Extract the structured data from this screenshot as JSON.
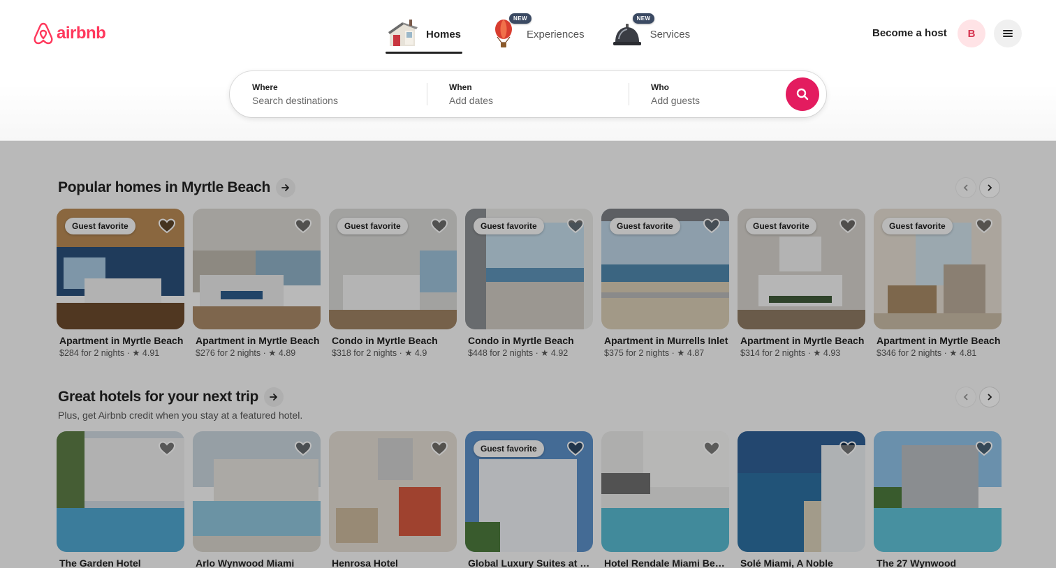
{
  "brand": {
    "name": "airbnb",
    "accent": "#ff385c"
  },
  "nav": {
    "tabs": [
      {
        "label": "Homes",
        "icon": "house-icon",
        "active": true
      },
      {
        "label": "Experiences",
        "icon": "hot-air-balloon-icon",
        "badge": "NEW"
      },
      {
        "label": "Services",
        "icon": "service-bell-icon",
        "badge": "NEW"
      }
    ]
  },
  "header": {
    "host_label": "Become a host",
    "avatar_initial": "B"
  },
  "search": {
    "where": {
      "label": "Where",
      "placeholder": "Search destinations"
    },
    "when": {
      "label": "When",
      "placeholder": "Add dates"
    },
    "who": {
      "label": "Who",
      "placeholder": "Add guests"
    },
    "button_color": "#e31c5f"
  },
  "sections": [
    {
      "title": "Popular homes in Myrtle Beach",
      "subtitle": "",
      "cards": [
        {
          "title": "Apartment in Myrtle Beach",
          "price": "$284 for 2 nights",
          "rating": "★ 4.91",
          "badge": "Guest favorite"
        },
        {
          "title": "Apartment in Myrtle Beach",
          "price": "$276 for 2 nights",
          "rating": "★ 4.89",
          "badge": ""
        },
        {
          "title": "Condo in Myrtle Beach",
          "price": "$318 for 2 nights",
          "rating": "★ 4.9",
          "badge": "Guest favorite"
        },
        {
          "title": "Condo in Myrtle Beach",
          "price": "$448 for 2 nights",
          "rating": "★ 4.92",
          "badge": "Guest favorite"
        },
        {
          "title": "Apartment in Murrells Inlet",
          "price": "$375 for 2 nights",
          "rating": "★ 4.87",
          "badge": "Guest favorite"
        },
        {
          "title": "Apartment in Myrtle Beach",
          "price": "$314 for 2 nights",
          "rating": "★ 4.93",
          "badge": "Guest favorite"
        },
        {
          "title": "Apartment in Myrtle Beach",
          "price": "$346 for 2 nights",
          "rating": "★ 4.81",
          "badge": "Guest favorite"
        }
      ]
    },
    {
      "title": "Great hotels for your next trip",
      "subtitle": "Plus, get Airbnb credit when you stay at a featured hotel.",
      "cards": [
        {
          "title": "The Garden Hotel",
          "badge": ""
        },
        {
          "title": "Arlo Wynwood Miami",
          "badge": ""
        },
        {
          "title": "Henrosa Hotel",
          "badge": ""
        },
        {
          "title": "Global Luxury Suites at The",
          "badge": "Guest favorite"
        },
        {
          "title": "Hotel Rendale Miami Beach",
          "badge": ""
        },
        {
          "title": "Solé Miami, A Noble",
          "badge": ""
        },
        {
          "title": "The 27 Wynwood",
          "badge": ""
        }
      ]
    }
  ]
}
